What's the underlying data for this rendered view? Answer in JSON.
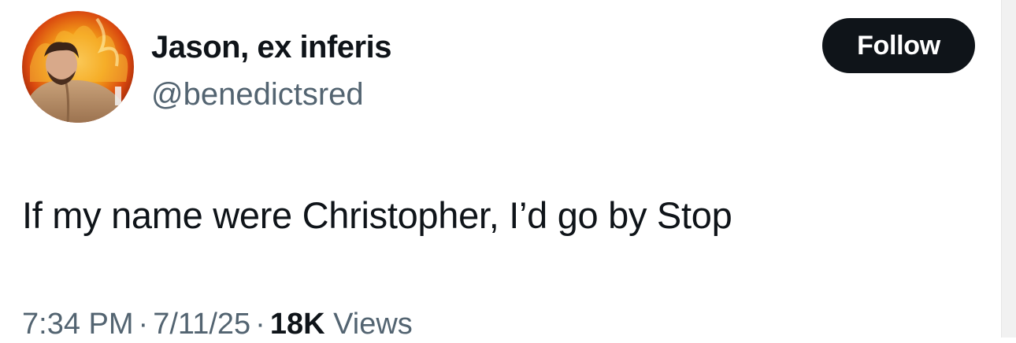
{
  "author": {
    "display_name": "Jason, ex inferis",
    "handle": "@benedictsred",
    "avatar_icon": "profile-photo-flames"
  },
  "actions": {
    "follow_label": "Follow"
  },
  "tweet": {
    "text": "If my name were Christopher, I’d go by Stop"
  },
  "meta": {
    "time": "7:34 PM",
    "separator": "·",
    "date": "7/11/25",
    "views_count": "18K",
    "views_label": "Views"
  },
  "colors": {
    "text_primary": "#0f1419",
    "text_secondary": "#536471",
    "button_bg": "#0f1419",
    "button_text": "#ffffff"
  }
}
